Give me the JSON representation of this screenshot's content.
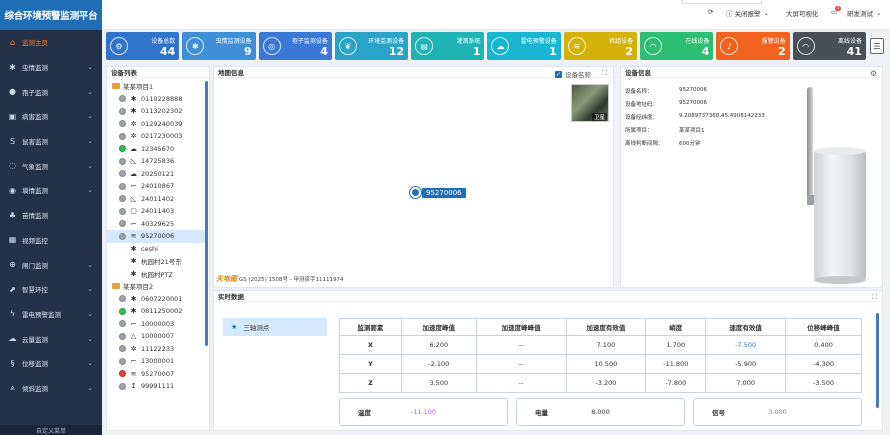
{
  "brand": "综合环境预警监测平台",
  "nav": [
    {
      "label": "监测主页",
      "icon": "home-icon",
      "active": true,
      "chev": false
    },
    {
      "label": "虫情监测",
      "icon": "bug-icon",
      "chev": true
    },
    {
      "label": "孢子监测",
      "icon": "spore-icon",
      "chev": true
    },
    {
      "label": "病害监测",
      "icon": "disease-icon",
      "chev": true
    },
    {
      "label": "鼠害监测",
      "icon": "rat-icon",
      "chev": true
    },
    {
      "label": "气象监测",
      "icon": "weather-icon",
      "chev": true
    },
    {
      "label": "墒情监测",
      "icon": "soil-icon",
      "chev": true
    },
    {
      "label": "苗情监测",
      "icon": "seedling-icon",
      "chev": false
    },
    {
      "label": "视频监控",
      "icon": "video-icon",
      "chev": false
    },
    {
      "label": "闸门监测",
      "icon": "gate-icon",
      "chev": true
    },
    {
      "label": "智慧环控",
      "icon": "control-icon",
      "chev": true
    },
    {
      "label": "雷电预警监测",
      "icon": "lightning-icon",
      "chev": true
    },
    {
      "label": "云量监测",
      "icon": "cloud-icon",
      "chev": true
    },
    {
      "label": "位移监测",
      "icon": "displacement-icon",
      "chev": true
    },
    {
      "label": "倾斜监测",
      "icon": "tilt-icon",
      "chev": true
    }
  ],
  "nav_footer": "自定义菜单",
  "topbar": {
    "alarm_toggle": "关闭报警",
    "bigscreen": "大屏可视化",
    "msg_badge": "1",
    "user": "研发测试"
  },
  "stats": [
    {
      "label": "设备总数",
      "value": "44",
      "color": "#2f74c9",
      "icon": "gear-icon",
      "glyph": "⚙"
    },
    {
      "label": "虫情监测设备",
      "value": "9",
      "color": "#3e8fd8",
      "icon": "bug-icon",
      "glyph": "✱"
    },
    {
      "label": "孢子监测设备",
      "value": "4",
      "color": "#3b78d6",
      "icon": "spore-icon",
      "glyph": "◎"
    },
    {
      "label": "环境监测设备",
      "value": "12",
      "color": "#2aa3c8",
      "icon": "leaf-icon",
      "glyph": "❦"
    },
    {
      "label": "灌溉系统",
      "value": "1",
      "color": "#1fb3b3",
      "icon": "irrigation-icon",
      "glyph": "▤"
    },
    {
      "label": "雷电预警设备",
      "value": "1",
      "color": "#19b6d1",
      "icon": "cloud-lightning-icon",
      "glyph": "☁"
    },
    {
      "label": "机组设备",
      "value": "2",
      "color": "#d4b20a",
      "icon": "wave-icon",
      "glyph": "≋"
    },
    {
      "label": "在线设备",
      "value": "4",
      "color": "#2cbf73",
      "icon": "wifi-icon",
      "glyph": "◠"
    },
    {
      "label": "报警设备",
      "value": "2",
      "color": "#f0621d",
      "icon": "bell-icon",
      "glyph": "♪"
    },
    {
      "label": "离线设备",
      "value": "41",
      "color": "#4a4f57",
      "icon": "wifi-off-icon",
      "glyph": "◠"
    }
  ],
  "device_list": {
    "title": "设备列表",
    "nodes": [
      {
        "type": "group",
        "label": "某某项目1"
      },
      {
        "type": "dev",
        "label": "0110228888",
        "status": "gray",
        "glyph": "✱"
      },
      {
        "type": "dev",
        "label": "0113202302",
        "status": "gray",
        "glyph": "✱"
      },
      {
        "type": "dev",
        "label": "0129240039",
        "status": "gray",
        "glyph": "✲"
      },
      {
        "type": "dev",
        "label": "0217230003",
        "status": "gray",
        "glyph": "✲"
      },
      {
        "type": "dev",
        "label": "12345670",
        "status": "green",
        "glyph": "☁"
      },
      {
        "type": "dev",
        "label": "14725836",
        "status": "gray",
        "glyph": "◺"
      },
      {
        "type": "dev",
        "label": "20250121",
        "status": "gray",
        "glyph": "☁"
      },
      {
        "type": "dev",
        "label": "24010867",
        "status": "gray",
        "glyph": "⌐"
      },
      {
        "type": "dev",
        "label": "24011402",
        "status": "gray",
        "glyph": "◺"
      },
      {
        "type": "dev",
        "label": "24011403",
        "status": "gray",
        "glyph": "▢"
      },
      {
        "type": "dev",
        "label": "40329625",
        "status": "gray",
        "glyph": "⌐"
      },
      {
        "type": "dev",
        "label": "95270006",
        "status": "gray",
        "glyph": "≋",
        "selected": true
      },
      {
        "type": "dev",
        "label": "ceshi",
        "status": "none",
        "glyph": "✱"
      },
      {
        "type": "dev",
        "label": "杭园村21号东",
        "status": "none",
        "glyph": "✱"
      },
      {
        "type": "dev",
        "label": "杭园村PTZ",
        "status": "none",
        "glyph": "✱"
      },
      {
        "type": "group",
        "label": "某某项目2"
      },
      {
        "type": "dev",
        "label": "0607220001",
        "status": "gray",
        "glyph": "✱"
      },
      {
        "type": "dev",
        "label": "0811250002",
        "status": "green",
        "glyph": "✱"
      },
      {
        "type": "dev",
        "label": "10000003",
        "status": "gray",
        "glyph": "⌐"
      },
      {
        "type": "dev",
        "label": "10000007",
        "status": "gray",
        "glyph": "△"
      },
      {
        "type": "dev",
        "label": "11122233",
        "status": "gray",
        "glyph": "✲"
      },
      {
        "type": "dev",
        "label": "13000001",
        "status": "gray",
        "glyph": "⌐"
      },
      {
        "type": "dev",
        "label": "95270007",
        "status": "red",
        "glyph": "≋"
      },
      {
        "type": "dev",
        "label": "99991111",
        "status": "gray",
        "glyph": "↥"
      }
    ]
  },
  "map": {
    "title": "地图信息",
    "toggle_label": "设备名称",
    "thumb_label": "卫星",
    "marker_label": "95270006",
    "copyright": "GS (2025) 1508号 - 甲测资字11111974"
  },
  "device_info": {
    "title": "设备信息",
    "rows": [
      {
        "k": "设备名称：",
        "v": "95270006"
      },
      {
        "k": "设备地址码：",
        "v": "95270006"
      },
      {
        "k": "设备经纬度：",
        "v": "9.2089737368,45.4908142233"
      },
      {
        "k": "所属项目：",
        "v": "某某项目1"
      },
      {
        "k": "离线判断间隔：",
        "v": "600分钟"
      }
    ]
  },
  "realtime": {
    "title": "实时数据",
    "point": "三轴测点",
    "headers": [
      "监测要素",
      "加速度峰值",
      "加速度峰峰值",
      "加速度有效值",
      "峭度",
      "速度有效值",
      "位移峰峰值"
    ],
    "rows": [
      [
        "X",
        "6.200",
        "--",
        "7.100",
        "1.700",
        "-7.500",
        "0.400"
      ],
      [
        "Y",
        "-2.100",
        "--",
        "10.500",
        "-11.800",
        "-5.900",
        "-4.300"
      ],
      [
        "Z",
        "3.500",
        "--",
        "-3.200",
        "-7.800",
        "7.000",
        "-3.500"
      ]
    ],
    "extra": [
      {
        "k": "温度",
        "v": "-11.100",
        "violet": true
      },
      {
        "k": "电量",
        "v": "8.000",
        "violet": false
      },
      {
        "k": "信号",
        "v": "3.000",
        "violet": true
      }
    ]
  }
}
